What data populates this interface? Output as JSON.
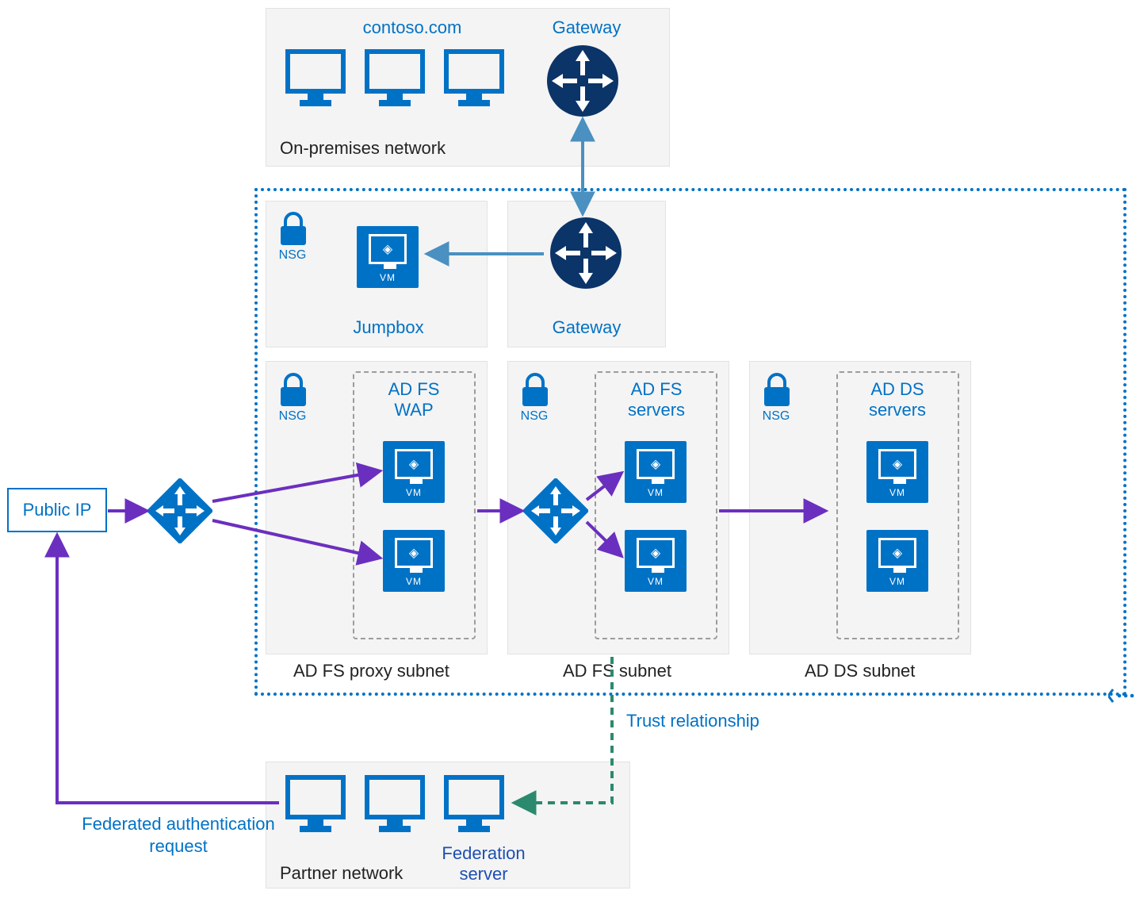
{
  "onprem": {
    "title": "contoso.com",
    "gateway_label": "Gateway",
    "caption": "On-premises network"
  },
  "vnet": {
    "jumpbox": {
      "nsg": "NSG",
      "label": "Jumpbox"
    },
    "gateway": {
      "label": "Gateway"
    },
    "wap": {
      "nsg": "NSG",
      "title": "AD FS WAP",
      "caption": "AD FS proxy subnet"
    },
    "adfs": {
      "nsg": "NSG",
      "title": "AD FS servers",
      "caption": "AD FS subnet"
    },
    "adds": {
      "nsg": "NSG",
      "title": "AD DS servers",
      "caption": "AD DS subnet"
    }
  },
  "public_ip": "Public IP",
  "partner": {
    "caption": "Partner network",
    "federation": "Federation server"
  },
  "labels": {
    "trust": "Trust relationship",
    "federated": "Federated authentication request"
  },
  "icons": {
    "vm": "VM"
  },
  "colors": {
    "azure_blue": "#0072c6",
    "purple": "#6b2fbf",
    "steel": "#4a90c0",
    "navy": "#0b3468",
    "teal": "#2b8a6e"
  }
}
